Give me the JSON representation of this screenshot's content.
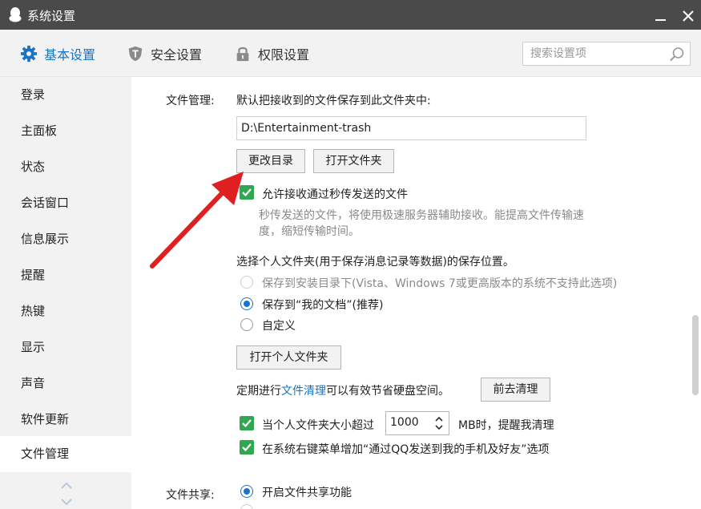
{
  "window": {
    "title": "系统设置"
  },
  "tabs": [
    {
      "label": "基本设置",
      "icon": "gear-icon",
      "active": true
    },
    {
      "label": "安全设置",
      "icon": "shield-icon",
      "active": false
    },
    {
      "label": "权限设置",
      "icon": "lock-icon",
      "active": false
    }
  ],
  "search": {
    "placeholder": "搜索设置项"
  },
  "sidebar": {
    "items": [
      {
        "label": "登录"
      },
      {
        "label": "主面板"
      },
      {
        "label": "状态"
      },
      {
        "label": "会话窗口"
      },
      {
        "label": "信息展示"
      },
      {
        "label": "提醒"
      },
      {
        "label": "热键"
      },
      {
        "label": "显示"
      },
      {
        "label": "声音"
      },
      {
        "label": "软件更新"
      },
      {
        "label": "文件管理",
        "active": true
      }
    ]
  },
  "file_mgmt": {
    "section_label": "文件管理:",
    "save_hint": "默认把接收到的文件保存到此文件夹中:",
    "path_value": "D:\\Entertainment-trash",
    "change_dir_button": "更改目录",
    "open_folder_button": "打开文件夹",
    "instant_transfer_label": "允许接收通过秒传发送的文件",
    "instant_transfer_desc_line1": "秒传发送的文件，将使用极速服务器辅助接收。能提高文件传输速",
    "instant_transfer_desc_line2": "度，缩短传输时间。",
    "personal_folder_prompt": "选择个人文件夹(用于保存消息记录等数据)的保存位置。",
    "radio_install_dir": "保存到安装目录下(Vista、Windows 7或更高版本的系统不支持此选项)",
    "radio_my_documents": "保存到“我的文档”(推荐)",
    "radio_custom": "自定义",
    "open_personal_folder_button": "打开个人文件夹",
    "cleanup_prefix": "定期进行",
    "cleanup_link": "文件清理",
    "cleanup_suffix": "可以有效节省硬盘空间。",
    "cleanup_button": "前去清理",
    "size_alert_prefix": "当个人文件夹大小超过",
    "size_alert_value": "1000",
    "size_alert_suffix": "MB时，提醒我清理",
    "context_menu_label": "在系统右键菜单增加“通过QQ发送到我的手机及好友”选项"
  },
  "file_share": {
    "section_label": "文件共享:",
    "enable_label": "开启文件共享功能"
  },
  "colors": {
    "accent": "#1a73c4",
    "check_green": "#2fa84f",
    "annotation_arrow": "#e02020",
    "titlebar": "#4a4a4a"
  }
}
